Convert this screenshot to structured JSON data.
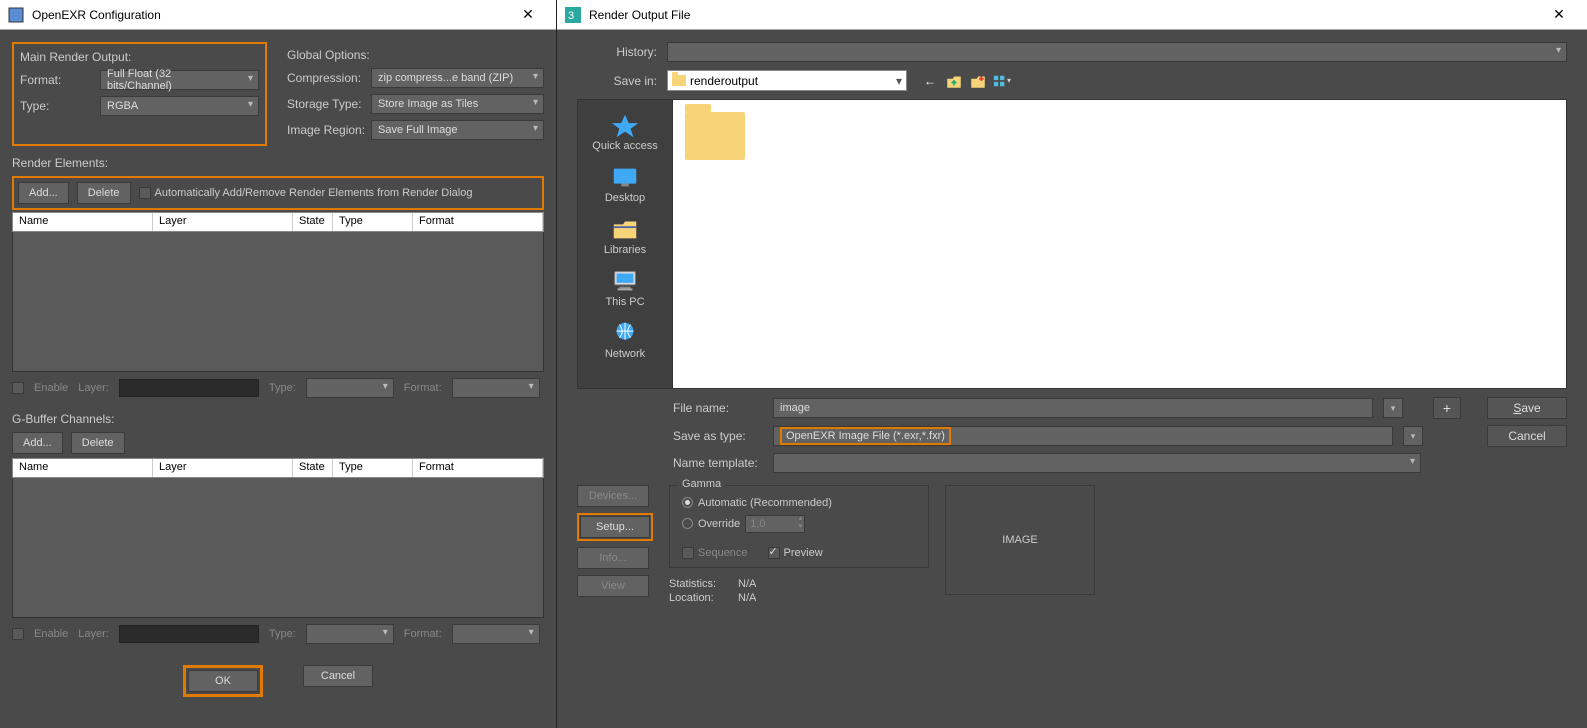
{
  "left": {
    "title": "OpenEXR Configuration",
    "mainRenderLabel": "Main Render Output:",
    "formatLabel": "Format:",
    "formatValue": "Full Float (32 bits/Channel)",
    "typeLabel": "Type:",
    "typeValue": "RGBA",
    "globalLabel": "Global Options:",
    "compressionLabel": "Compression:",
    "compressionValue": "zip compress...e band (ZIP)",
    "storageLabel": "Storage Type:",
    "storageValue": "Store Image as Tiles",
    "regionLabel": "Image Region:",
    "regionValue": "Save Full Image",
    "renderElementsLabel": "Render Elements:",
    "addBtn": "Add...",
    "deleteBtn": "Delete",
    "autoAddLabel": "Automatically Add/Remove Render Elements from Render Dialog",
    "colName": "Name",
    "colLayer": "Layer",
    "colState": "State",
    "colType": "Type",
    "colFormat": "Format",
    "enableLabel": "Enable",
    "layerLabel": "Layer:",
    "optTypeLabel": "Type:",
    "optFormatLabel": "Format:",
    "gbufferLabel": "G-Buffer Channels:",
    "okBtn": "OK",
    "cancelBtn": "Cancel"
  },
  "right": {
    "title": "Render Output File",
    "historyLabel": "History:",
    "saveinLabel": "Save in:",
    "saveinValue": "renderoutput",
    "places": {
      "quick": "Quick access",
      "desktop": "Desktop",
      "libraries": "Libraries",
      "thispc": "This PC",
      "network": "Network"
    },
    "fileNameLabel": "File name:",
    "fileNameValue": "image",
    "saveAsLabel": "Save as type:",
    "saveAsValue": "OpenEXR Image File (*.exr,*.fxr)",
    "nameTemplateLabel": "Name template:",
    "plusBtn": "+",
    "saveBtn": "Save",
    "cancelBtn": "Cancel",
    "devicesBtn": "Devices...",
    "setupBtn": "Setup...",
    "infoBtn": "Info...",
    "viewBtn": "View",
    "gammaLabel": "Gamma",
    "autoLabel": "Automatic (Recommended)",
    "overrideLabel": "Override",
    "overrideValue": "1,0",
    "sequenceLabel": "Sequence",
    "previewLabel": "Preview",
    "imagePreview": "IMAGE",
    "statsLabel": "Statistics:",
    "statsValue": "N/A",
    "locationLabel": "Location:",
    "locationValue": "N/A"
  }
}
